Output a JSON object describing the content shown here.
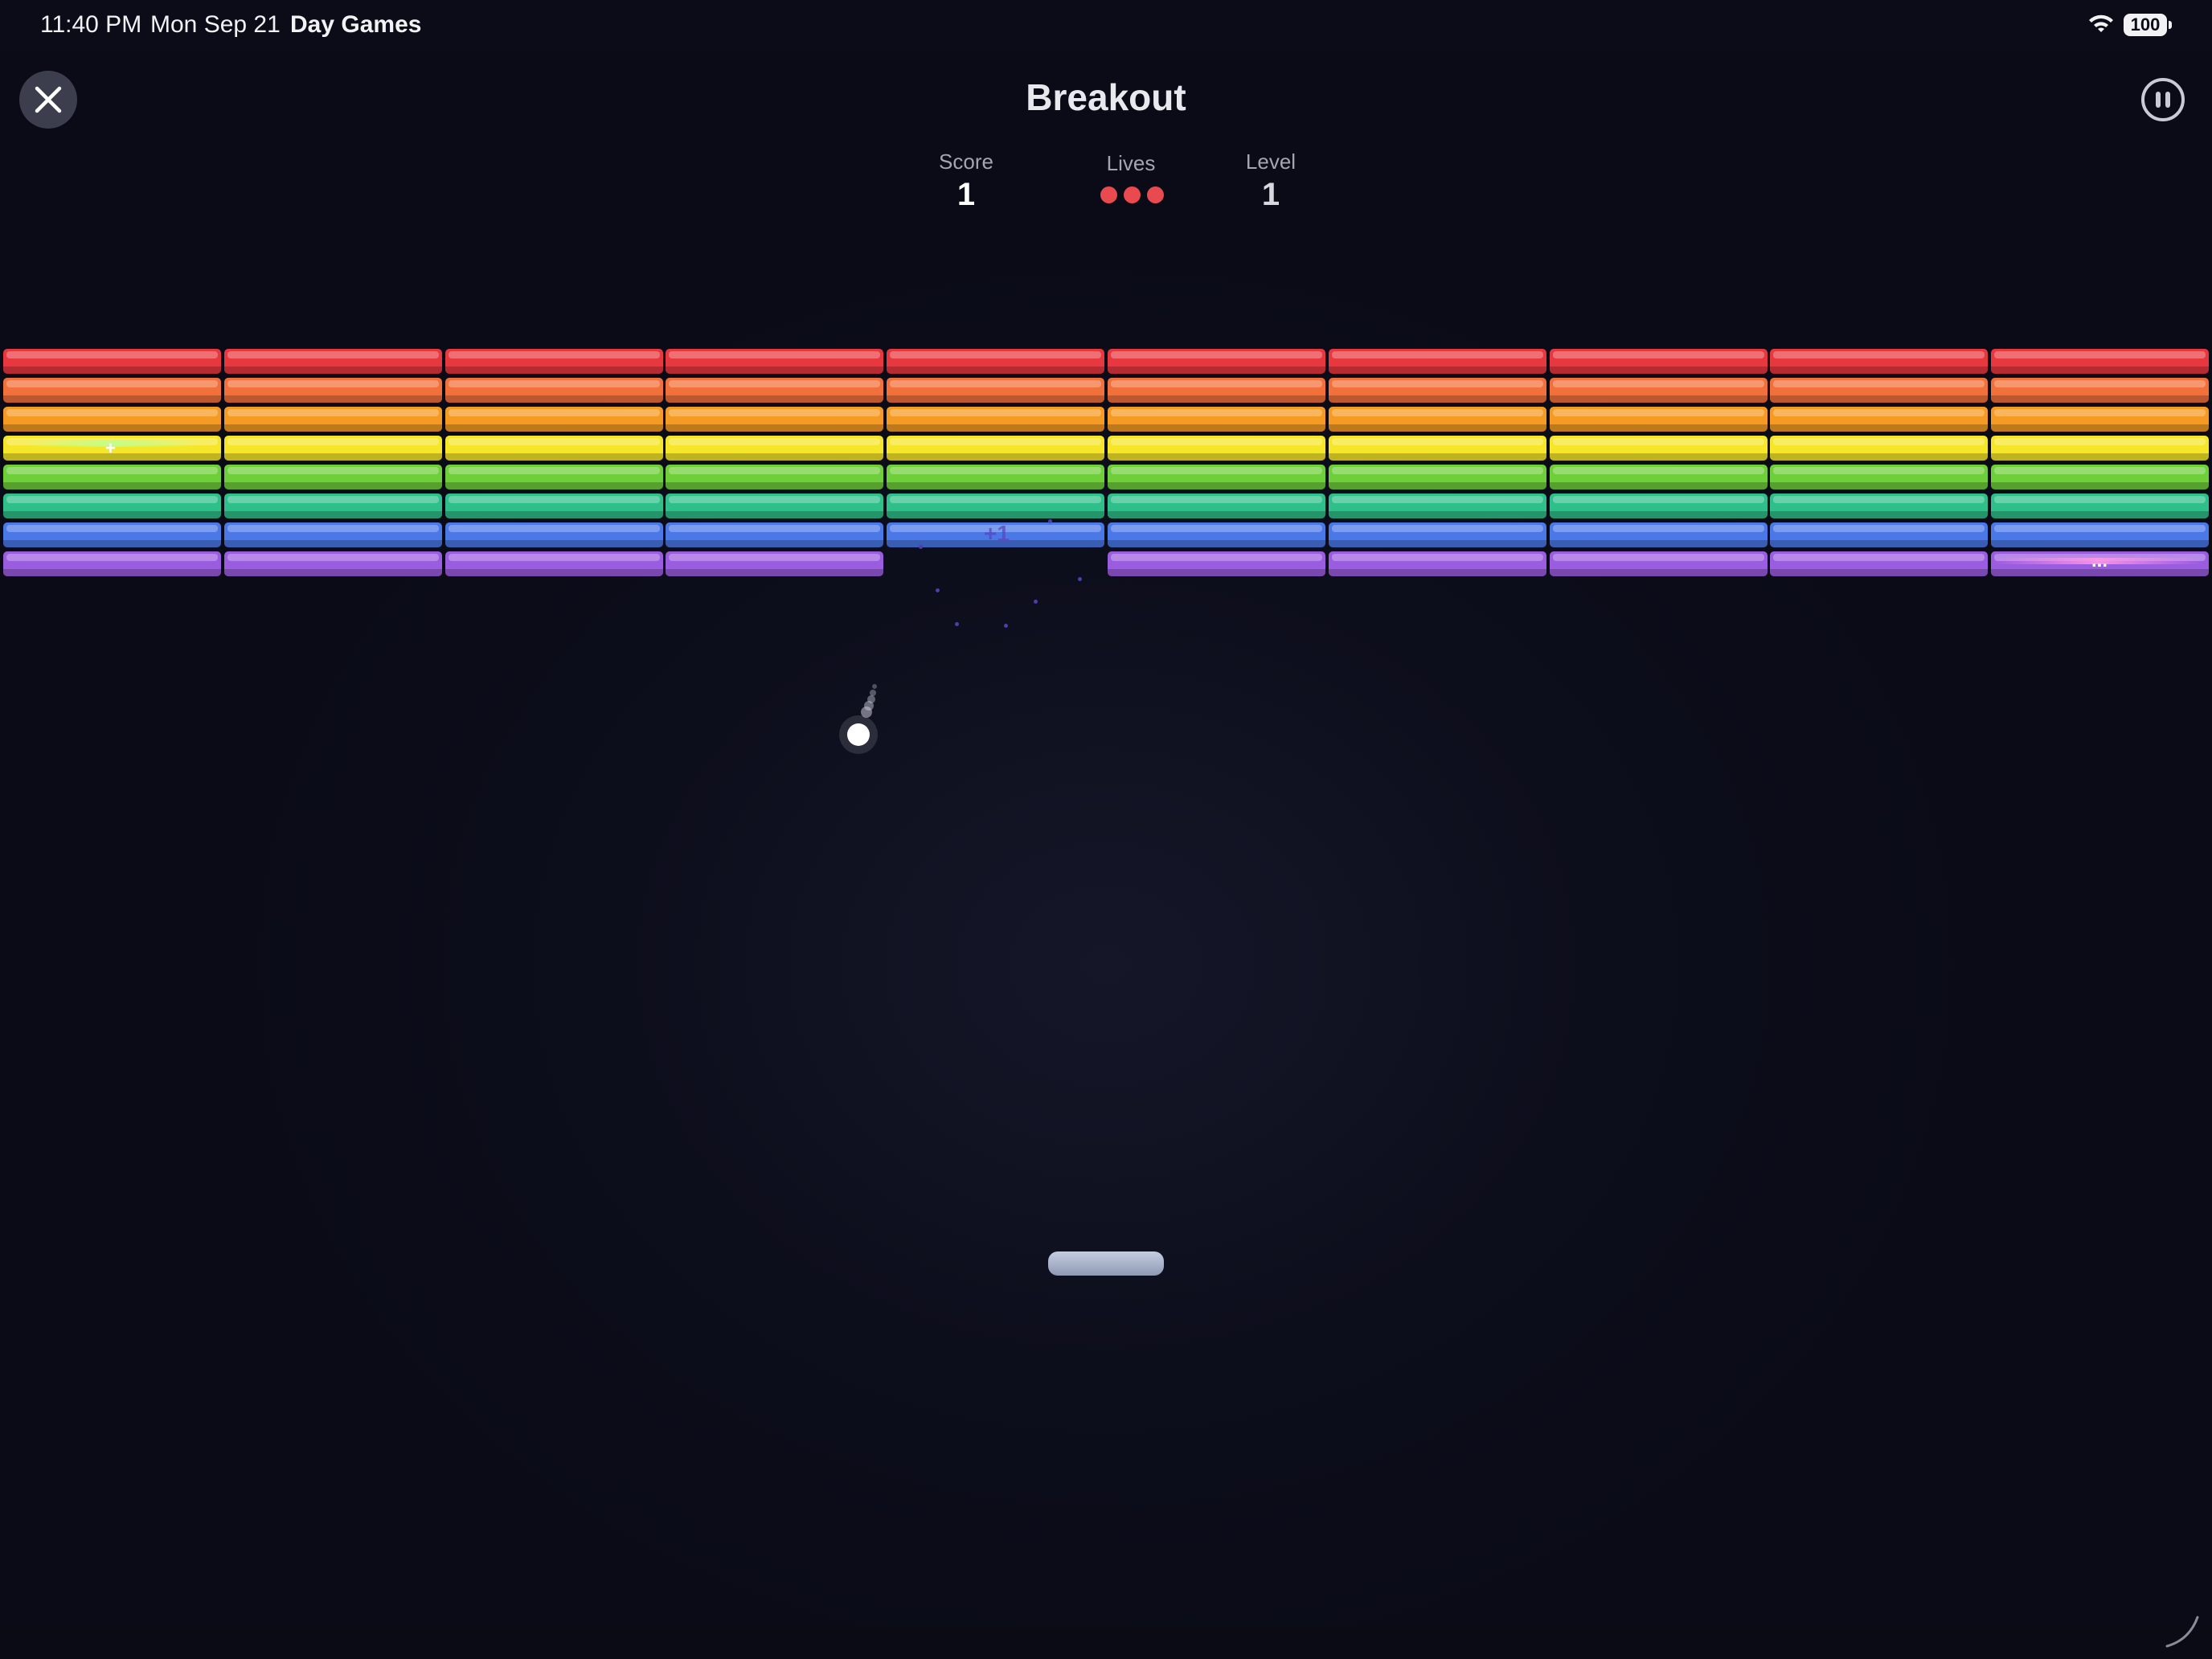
{
  "status_bar": {
    "time": "11:40 PM",
    "date": "Mon Sep 21",
    "app_name": "Day Games",
    "battery": "100"
  },
  "header": {
    "title": "Breakout",
    "close_icon": "close-icon",
    "pause_icon": "pause-icon"
  },
  "stats": {
    "score_label": "Score",
    "score_value": "1",
    "lives_label": "Lives",
    "lives_count": 3,
    "level_label": "Level",
    "level_value": "1"
  },
  "game": {
    "columns": 10,
    "rows": [
      {
        "color": "#e8383f",
        "name": "red"
      },
      {
        "color": "#f2703a",
        "name": "orange"
      },
      {
        "color": "#f59a22",
        "name": "amber"
      },
      {
        "color": "#f5e62a",
        "name": "yellow"
      },
      {
        "color": "#6fcf3a",
        "name": "green"
      },
      {
        "color": "#2fbf8a",
        "name": "teal"
      },
      {
        "color": "#4a78e6",
        "name": "blue"
      },
      {
        "color": "#9b5de0",
        "name": "purple"
      }
    ],
    "missing_bricks": [
      {
        "row": 7,
        "col": 4
      }
    ],
    "score_popup": "+1",
    "sparkle_marker": "+",
    "ellipsis_marker": "...",
    "accent_colors": {
      "life": "#e84a4f",
      "paddle": "#aeb7cc",
      "ball": "#ffffff"
    }
  }
}
